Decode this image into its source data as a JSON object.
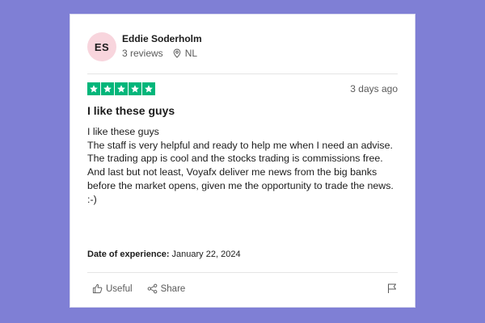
{
  "reviewer": {
    "initials": "ES",
    "name": "Eddie Soderholm",
    "reviews": "3 reviews",
    "country": "NL"
  },
  "review": {
    "rating": 5,
    "date": "3 days ago",
    "title": "I like these guys",
    "body": [
      "I like these guys",
      "The staff is very helpful and ready to help me when I need an advise.",
      "The trading app is cool and the stocks trading is commissions free.",
      "And last but not least, Voyafx deliver me news from the big banks before the market opens, given me the opportunity to trade the news. :-)"
    ],
    "experience_label": "Date of experience:",
    "experience_date": "January 22, 2024"
  },
  "actions": {
    "useful_label": "Useful",
    "share_label": "Share"
  },
  "icons": {
    "location": "location-pin-icon",
    "star": "star-icon",
    "useful": "thumbs-up-icon",
    "share": "share-icon",
    "flag": "flag-icon"
  },
  "colors": {
    "background": "#7f7fd5",
    "star_green": "#00b67a",
    "avatar_bg": "#f8d5dd"
  }
}
